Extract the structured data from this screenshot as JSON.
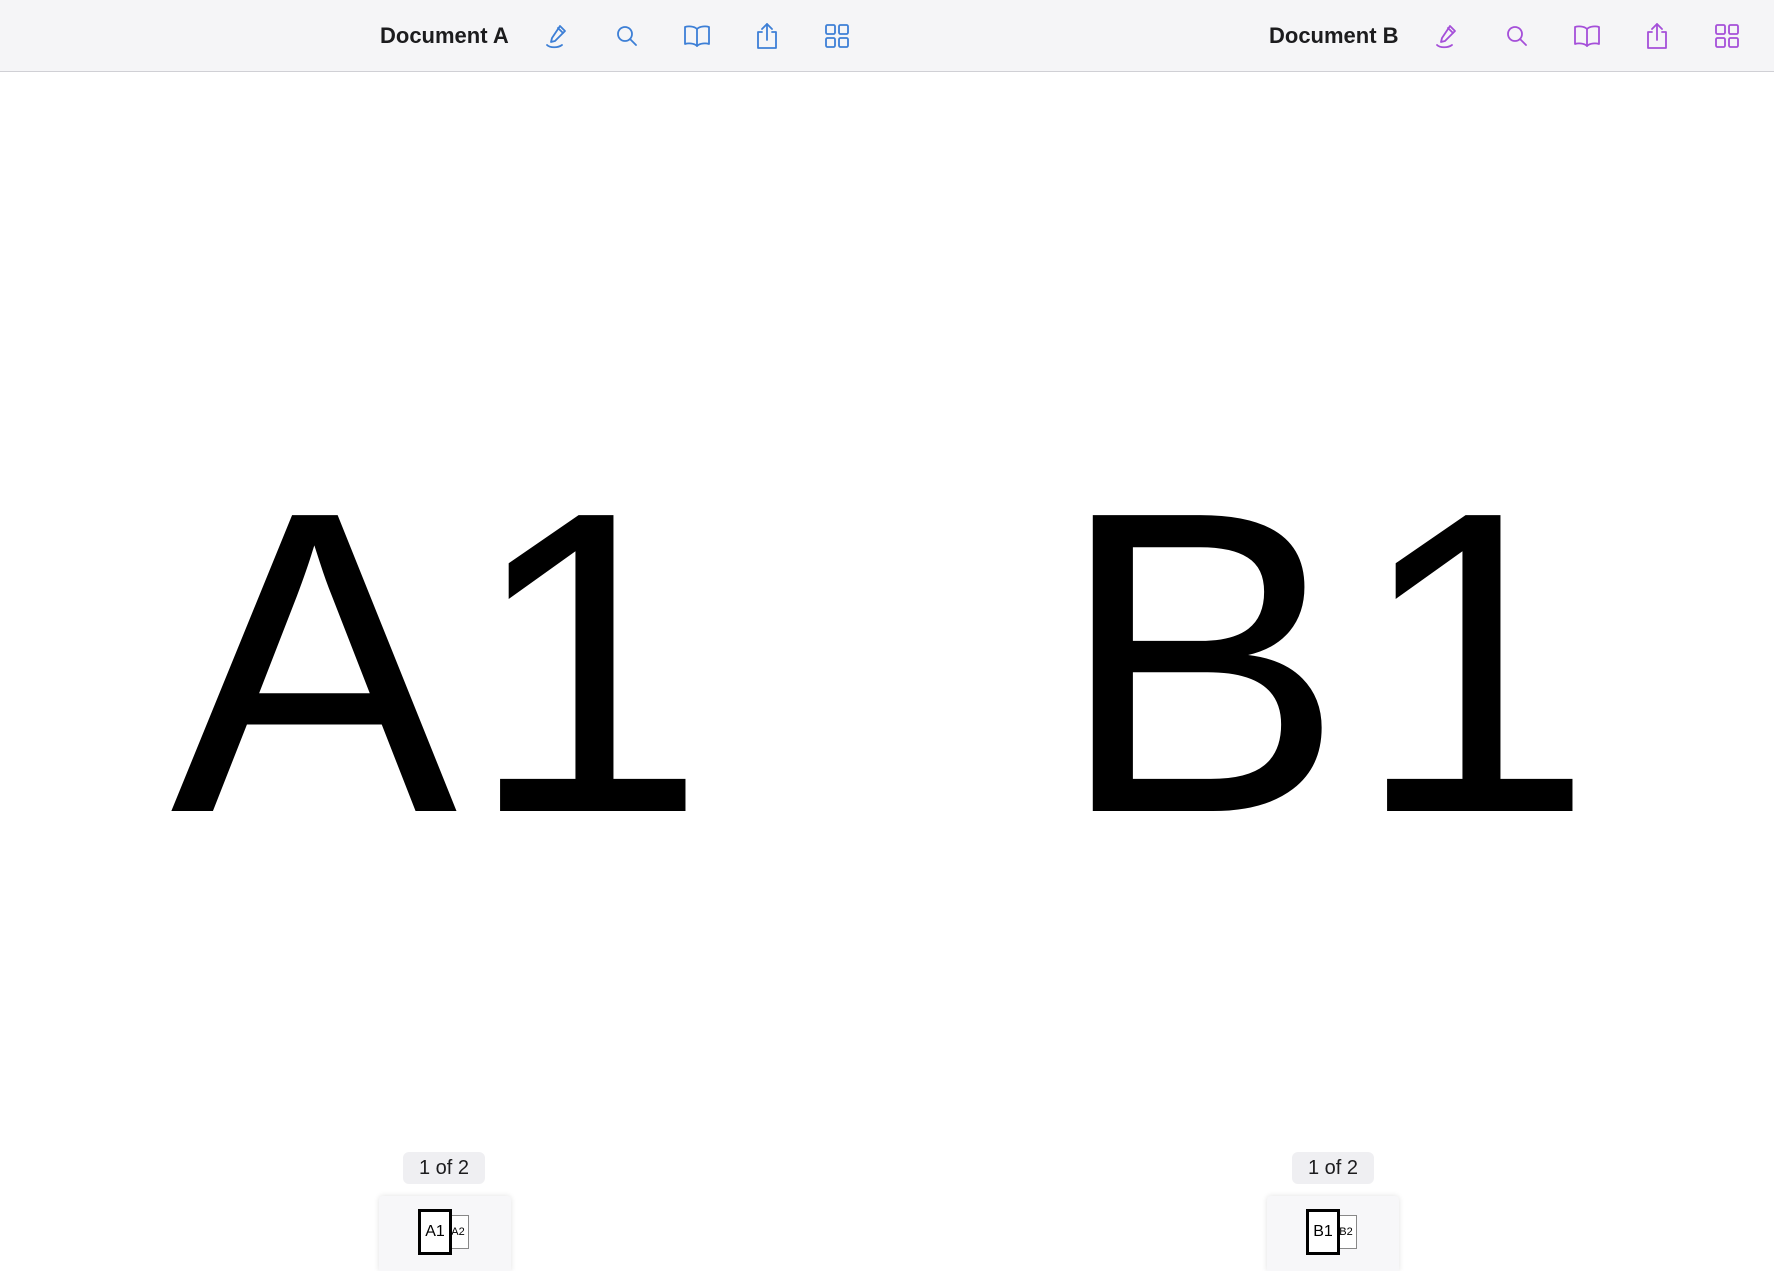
{
  "panes": [
    {
      "id": "a",
      "title": "Document A",
      "accent": "#3d7fd6",
      "toolbar_icons": [
        "markup-pen-icon",
        "search-icon",
        "book-icon",
        "share-icon",
        "grid-icon"
      ],
      "page_content": "A1",
      "page_indicator": "1 of 2",
      "thumbnails": [
        "A1",
        "A2"
      ]
    },
    {
      "id": "b",
      "title": "Document B",
      "accent": "#a54fd9",
      "toolbar_icons": [
        "markup-pen-icon",
        "search-icon",
        "book-icon",
        "share-icon",
        "grid-icon"
      ],
      "page_content": "B1",
      "page_indicator": "1 of 2",
      "thumbnails": [
        "B1",
        "B2"
      ]
    }
  ]
}
